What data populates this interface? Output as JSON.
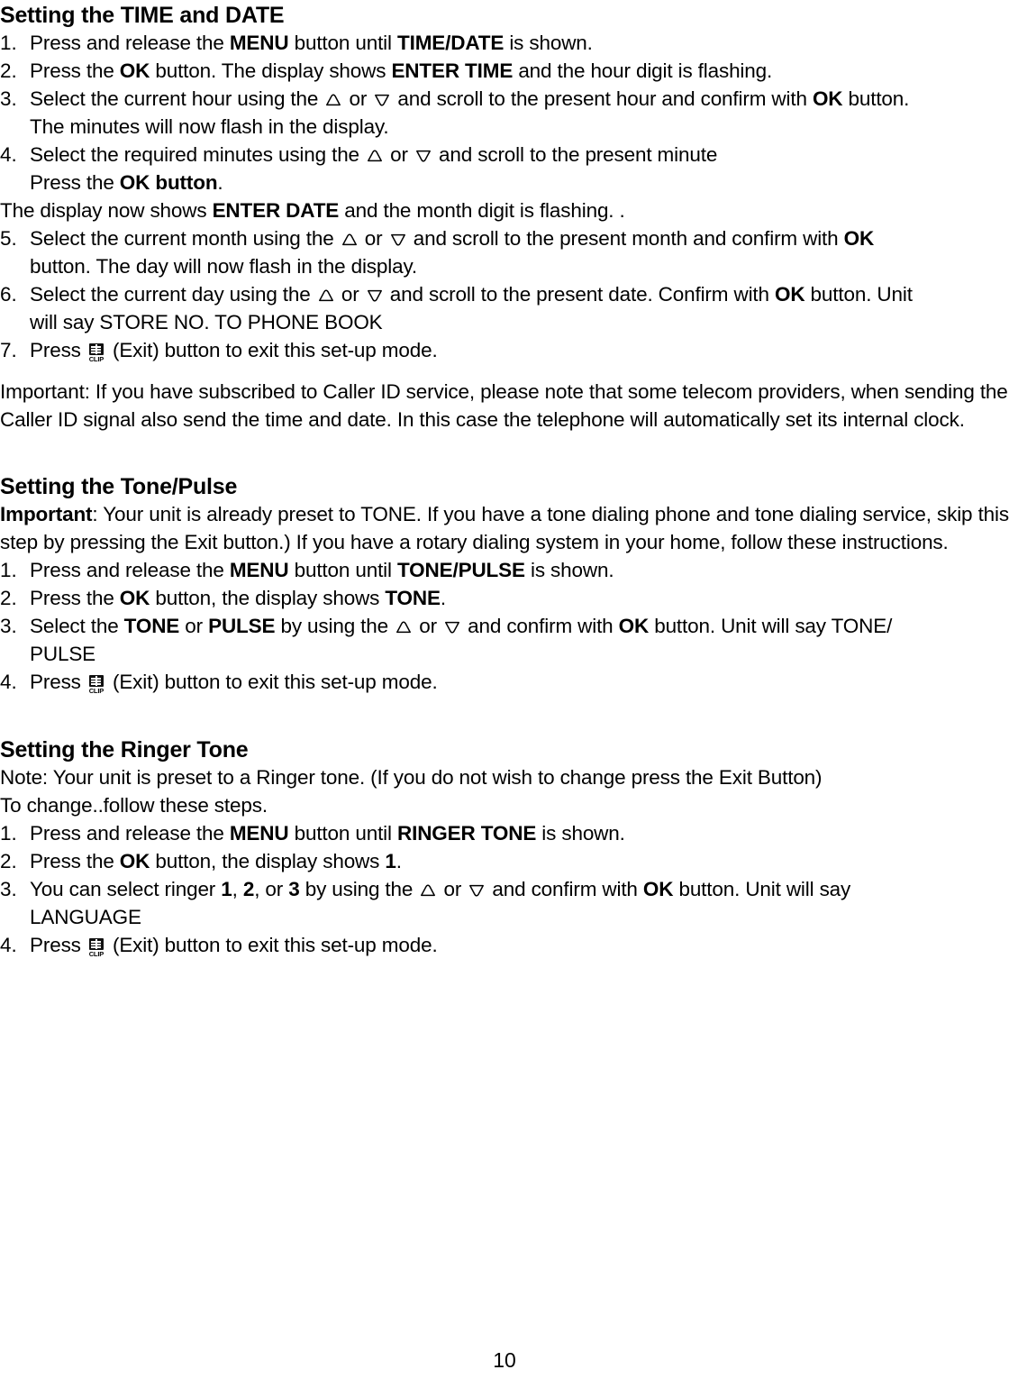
{
  "document": {
    "page_number": "10",
    "icons": {
      "up_arrow": "triangle-up-icon",
      "down_arrow": "triangle-down-icon",
      "clip_exit": "clip-exit-icon",
      "clip_label": "CLIP"
    }
  },
  "sections": [
    {
      "id": "time-and-date",
      "heading": "Setting the TIME and DATE",
      "steps": [
        {
          "number": "1.",
          "parts": [
            {
              "t": "Press and release the ",
              "b": false
            },
            {
              "t": "MENU",
              "b": true
            },
            {
              "t": " button until ",
              "b": false
            },
            {
              "t": "TIME/DATE",
              "b": true
            },
            {
              "t": " is shown.",
              "b": false
            }
          ]
        },
        {
          "number": "2.",
          "parts": [
            {
              "t": "Press the ",
              "b": false
            },
            {
              "t": "OK",
              "b": true
            },
            {
              "t": " button. The display shows ",
              "b": false
            },
            {
              "t": "ENTER TIME",
              "b": true
            },
            {
              "t": " and the hour digit is flashing.",
              "b": false
            }
          ]
        },
        {
          "number": "3.",
          "parts": [
            {
              "t": "Select the current hour using the ",
              "b": false
            },
            {
              "icon": "up"
            },
            {
              "t": " or ",
              "b": false
            },
            {
              "icon": "down"
            },
            {
              "t": " and scroll to the present hour and confirm with ",
              "b": false
            },
            {
              "t": "OK",
              "b": true
            },
            {
              "t": " button.",
              "b": false
            }
          ],
          "continuation": [
            {
              "parts": [
                {
                  "t": "The minutes will now flash in the display.",
                  "b": false
                }
              ]
            }
          ]
        },
        {
          "number": "4.",
          "parts": [
            {
              "t": "Select the required minutes using the ",
              "b": false
            },
            {
              "icon": "up"
            },
            {
              "t": " or ",
              "b": false
            },
            {
              "icon": "down"
            },
            {
              "t": " and scroll to the present minute",
              "b": false
            }
          ],
          "continuation": [
            {
              "parts": [
                {
                  "t": "Press the ",
                  "b": false
                },
                {
                  "t": "OK button",
                  "b": true
                },
                {
                  "t": ".",
                  "b": false
                }
              ]
            }
          ]
        }
      ],
      "interleaved_note": {
        "parts": [
          {
            "t": "The display now shows ",
            "b": false
          },
          {
            "t": "ENTER DATE",
            "b": true
          },
          {
            "t": " and the month digit is flashing. .",
            "b": false
          }
        ]
      },
      "steps2": [
        {
          "number": "5.",
          "justify": true,
          "parts": [
            {
              "t": "Select the current month using the ",
              "b": false
            },
            {
              "icon": "up"
            },
            {
              "t": " or ",
              "b": false
            },
            {
              "icon": "down"
            },
            {
              "t": "  and scroll to the present month and confirm with ",
              "b": false
            },
            {
              "t": "OK",
              "b": true
            }
          ],
          "continuation": [
            {
              "parts": [
                {
                  "t": "button. The day will now flash in the display.",
                  "b": false
                }
              ]
            }
          ]
        },
        {
          "number": "6.",
          "parts": [
            {
              "t": "Select the current day using the ",
              "b": false
            },
            {
              "icon": "up"
            },
            {
              "t": " or ",
              "b": false
            },
            {
              "icon": "down"
            },
            {
              "t": " and scroll to the present date. Confirm with ",
              "b": false
            },
            {
              "t": "OK",
              "b": true
            },
            {
              "t": " button. Unit",
              "b": false
            }
          ],
          "continuation": [
            {
              "parts": [
                {
                  "t": "will say STORE NO. TO PHONE BOOK",
                  "b": false
                }
              ]
            }
          ]
        },
        {
          "number": "7.",
          "parts": [
            {
              "t": "Press ",
              "b": false
            },
            {
              "icon": "clip"
            },
            {
              "t": " (Exit) button to exit this set-up mode.",
              "b": false
            }
          ]
        }
      ],
      "trailing_paragraph": {
        "parts": [
          {
            "t": "Important: If you have subscribed to Caller ID service, please note that some telecom providers, when sending the Caller ID signal also send the time and date.  In this case the telephone will automatically set its internal clock.",
            "b": false
          }
        ]
      }
    },
    {
      "id": "tone-pulse",
      "heading": "Setting the Tone/Pulse",
      "intro": {
        "justify": true,
        "parts": [
          {
            "t": "Important",
            "b": true
          },
          {
            "t": ": Your unit is already preset to TONE. If you have a tone dialing phone and tone dialing service, skip this step by pressing the Exit button.) If you have a rotary dialing system in your home, follow these instructions.",
            "b": false
          }
        ]
      },
      "steps": [
        {
          "number": "1.",
          "parts": [
            {
              "t": "Press and release the ",
              "b": false
            },
            {
              "t": "MENU",
              "b": true
            },
            {
              "t": " button until ",
              "b": false
            },
            {
              "t": "TONE/PULSE",
              "b": true
            },
            {
              "t": " is shown.",
              "b": false
            }
          ]
        },
        {
          "number": "2.",
          "parts": [
            {
              "t": "Press the ",
              "b": false
            },
            {
              "t": "OK",
              "b": true
            },
            {
              "t": " button, the display shows ",
              "b": false
            },
            {
              "t": "TONE",
              "b": true
            },
            {
              "t": ".",
              "b": false
            }
          ]
        },
        {
          "number": "3.",
          "justify": true,
          "parts": [
            {
              "t": "Select the ",
              "b": false
            },
            {
              "t": "TONE",
              "b": true
            },
            {
              "t": " or ",
              "b": false
            },
            {
              "t": "PULSE",
              "b": true
            },
            {
              "t": " by using the ",
              "b": false
            },
            {
              "icon": "up"
            },
            {
              "t": " or ",
              "b": false
            },
            {
              "icon": "down"
            },
            {
              "t": " and confirm with ",
              "b": false
            },
            {
              "t": "OK",
              "b": true
            },
            {
              "t": " button. Unit will say TONE/",
              "b": false
            }
          ],
          "continuation": [
            {
              "parts": [
                {
                  "t": "PULSE",
                  "b": false
                }
              ]
            }
          ]
        },
        {
          "number": "4.",
          "parts": [
            {
              "t": "Press ",
              "b": false
            },
            {
              "icon": "clip"
            },
            {
              "t": " (Exit) button to exit this set-up mode.",
              "b": false
            }
          ]
        }
      ]
    },
    {
      "id": "ringer-tone",
      "heading": "Setting the Ringer Tone",
      "notes": [
        {
          "parts": [
            {
              "t": "Note: Your unit is preset to a Ringer tone. (If you do not wish to change press the Exit Button)",
              "b": false
            }
          ]
        },
        {
          "parts": [
            {
              "t": "To change..follow these steps.",
              "b": false
            }
          ]
        }
      ],
      "steps": [
        {
          "number": "1.",
          "parts": [
            {
              "t": "Press and release the ",
              "b": false
            },
            {
              "t": "MENU",
              "b": true
            },
            {
              "t": " button until ",
              "b": false
            },
            {
              "t": "RINGER TONE",
              "b": true
            },
            {
              "t": " is shown.",
              "b": false
            }
          ]
        },
        {
          "number": "2.",
          "parts": [
            {
              "t": "Press the ",
              "b": false
            },
            {
              "t": "OK",
              "b": true
            },
            {
              "t": " button, the display shows ",
              "b": false
            },
            {
              "t": "1",
              "b": true
            },
            {
              "t": ".",
              "b": false
            }
          ]
        },
        {
          "number": "3.",
          "justify": true,
          "parts": [
            {
              "t": "You can select ringer ",
              "b": false
            },
            {
              "t": "1",
              "b": true
            },
            {
              "t": ", ",
              "b": false
            },
            {
              "t": "2",
              "b": true
            },
            {
              "t": ", or ",
              "b": false
            },
            {
              "t": "3",
              "b": true
            },
            {
              "t": " by using the ",
              "b": false
            },
            {
              "icon": "up"
            },
            {
              "t": " or ",
              "b": false
            },
            {
              "icon": "down"
            },
            {
              "t": " and confirm with ",
              "b": false
            },
            {
              "t": "OK",
              "b": true
            },
            {
              "t": " button. Unit will say",
              "b": false
            }
          ],
          "continuation": [
            {
              "parts": [
                {
                  "t": "LANGUAGE",
                  "b": false
                }
              ]
            }
          ]
        },
        {
          "number": "4.",
          "parts": [
            {
              "t": "Press ",
              "b": false
            },
            {
              "icon": "clip"
            },
            {
              "t": " (Exit) button to exit this set-up mode.",
              "b": false
            }
          ]
        }
      ]
    }
  ]
}
